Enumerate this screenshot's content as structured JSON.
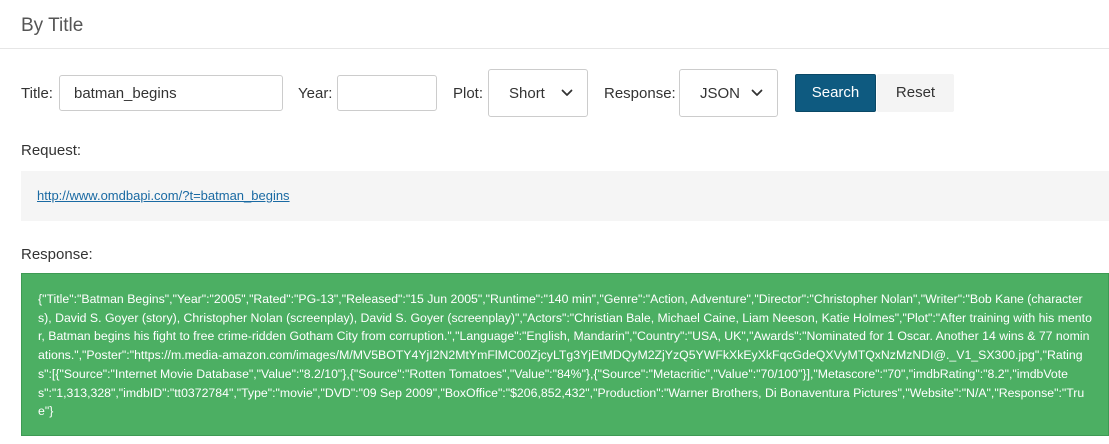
{
  "section": {
    "title": "By Title"
  },
  "form": {
    "title_label": "Title:",
    "title_value": "batman_begins",
    "year_label": "Year:",
    "year_value": "",
    "plot_label": "Plot:",
    "plot_value": "Short",
    "response_label": "Response:",
    "response_value": "JSON",
    "search_label": "Search",
    "reset_label": "Reset"
  },
  "request": {
    "label": "Request:",
    "url": "http://www.omdbapi.com/?t=batman_begins"
  },
  "response": {
    "label": "Response:",
    "body": "{\"Title\":\"Batman Begins\",\"Year\":\"2005\",\"Rated\":\"PG-13\",\"Released\":\"15 Jun 2005\",\"Runtime\":\"140 min\",\"Genre\":\"Action, Adventure\",\"Director\":\"Christopher Nolan\",\"Writer\":\"Bob Kane (characters), David S. Goyer (story), Christopher Nolan (screenplay), David S. Goyer (screenplay)\",\"Actors\":\"Christian Bale, Michael Caine, Liam Neeson, Katie Holmes\",\"Plot\":\"After training with his mentor, Batman begins his fight to free crime-ridden Gotham City from corruption.\",\"Language\":\"English, Mandarin\",\"Country\":\"USA, UK\",\"Awards\":\"Nominated for 1 Oscar. Another 14 wins & 77 nominations.\",\"Poster\":\"https://m.media-amazon.com/images/M/MV5BOTY4YjI2N2MtYmFlMC00ZjcyLTg3YjEtMDQyM2ZjYzQ5YWFkXkEyXkFqcGdeQXVyMTQxNzMzNDI@._V1_SX300.jpg\",\"Ratings\":[{\"Source\":\"Internet Movie Database\",\"Value\":\"8.2/10\"},{\"Source\":\"Rotten Tomatoes\",\"Value\":\"84%\"},{\"Source\":\"Metacritic\",\"Value\":\"70/100\"}],\"Metascore\":\"70\",\"imdbRating\":\"8.2\",\"imdbVotes\":\"1,313,328\",\"imdbID\":\"tt0372784\",\"Type\":\"movie\",\"DVD\":\"09 Sep 2009\",\"BoxOffice\":\"$206,852,432\",\"Production\":\"Warner Brothers, Di Bonaventura Pictures\",\"Website\":\"N/A\",\"Response\":\"True\"}"
  },
  "icons": {
    "plot_select": "chevron-down-icon",
    "response_select": "chevron-down-icon"
  },
  "colors": {
    "search_button": "#0e5a80",
    "response_background": "#4caf63",
    "link": "#1a6aa3"
  }
}
